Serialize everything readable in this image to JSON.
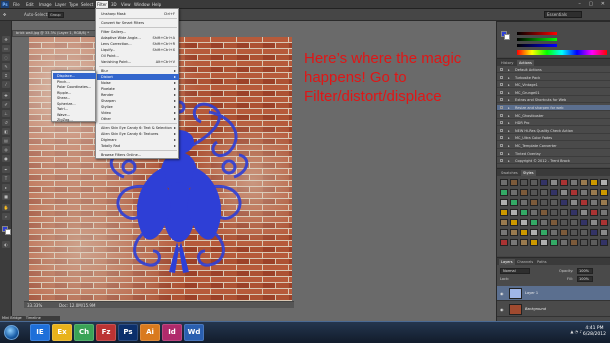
{
  "app": {
    "logo": "Ps"
  },
  "menubar": {
    "items": [
      "File",
      "Edit",
      "Image",
      "Layer",
      "Type",
      "Select",
      "Filter",
      "3D",
      "View",
      "Window",
      "Help"
    ]
  },
  "options_bar": {
    "auto_select_label": "Auto-Select:",
    "auto_select_value": "Group",
    "workspace": "Essentials"
  },
  "document": {
    "tab_title": "brick wall.jpg @ 33.3% (Layer 1, RGB/8) *",
    "zoom": "33.33%",
    "doc_size": "Doc: 12.0M/15.9M"
  },
  "filter_menu": {
    "items": [
      {
        "label": "Unsharp Mask",
        "shortcut": "Ctrl+F"
      },
      {
        "sep": true
      },
      {
        "label": "Convert for Smart Filters"
      },
      {
        "sep": true
      },
      {
        "label": "Filter Gallery..."
      },
      {
        "label": "Adaptive Wide Angle...",
        "shortcut": "Shift+Ctrl+A"
      },
      {
        "label": "Lens Correction...",
        "shortcut": "Shift+Ctrl+R"
      },
      {
        "label": "Liquify...",
        "shortcut": "Shift+Ctrl+X"
      },
      {
        "label": "Oil Paint..."
      },
      {
        "label": "Vanishing Point...",
        "shortcut": "Alt+Ctrl+V"
      },
      {
        "sep": true
      },
      {
        "label": "Blur",
        "submenu": true
      },
      {
        "label": "Distort",
        "submenu": true,
        "highlight": true
      },
      {
        "label": "Noise",
        "submenu": true
      },
      {
        "label": "Pixelate",
        "submenu": true
      },
      {
        "label": "Render",
        "submenu": true
      },
      {
        "label": "Sharpen",
        "submenu": true
      },
      {
        "label": "Stylize",
        "submenu": true
      },
      {
        "label": "Video",
        "submenu": true
      },
      {
        "label": "Other",
        "submenu": true
      },
      {
        "sep": true
      },
      {
        "label": "Alien Skin Eye Candy 6: Text & Selection",
        "submenu": true
      },
      {
        "label": "Alien Skin Eye Candy 6: Textures",
        "submenu": true
      },
      {
        "label": "Digimarc",
        "submenu": true
      },
      {
        "label": "Totally Rad",
        "submenu": true
      },
      {
        "sep": true
      },
      {
        "label": "Browse Filters Online..."
      }
    ]
  },
  "distort_menu": {
    "items": [
      "Displace...",
      "Pinch...",
      "Polar Coordinates...",
      "Ripple...",
      "Shear...",
      "Spherize...",
      "Twirl...",
      "Wave...",
      "ZigZag..."
    ],
    "highlighted": "Displace..."
  },
  "annotation": "Here’s where the magic happens! Go to Filter/distort/displace",
  "panels": {
    "history_tab": "History",
    "actions_tab": "Actions",
    "actions": [
      "Default Actions",
      "Turbosite Pack",
      "MC_Vintage1",
      "MC_Grunge01",
      "Extras and Shortcuts for Web",
      "Resize and sharpen for web",
      "MC_Ghostbuster",
      "HDR Pro",
      "NEW Hi-Res Quality Check Action",
      "MC_Ultra Color Fades",
      "MC_Template Converter",
      "Tinted Overlay",
      "Copyright © 2012 - Trent Brock"
    ],
    "selected_action_index": 5,
    "swatches_tab": "Swatches",
    "styles_tab": "Styles",
    "layers_tab": "Layers",
    "channels_tab": "Channels",
    "paths_tab": "Paths",
    "blend_mode": "Normal",
    "opacity_label": "Opacity:",
    "opacity": "100%",
    "lock_label": "Lock:",
    "fill_label": "Fill:",
    "fill": "100%",
    "layers": [
      {
        "name": "Layer 1",
        "selected": true
      },
      {
        "name": "Background",
        "selected": false
      }
    ]
  },
  "status": {
    "mini_bridge": "Mini Bridge",
    "timeline": "Timeline"
  },
  "taskbar": {
    "time": "4:41 PM",
    "date": "6/28/2012",
    "apps": [
      "IE",
      "Ex",
      "Ch",
      "Fz",
      "Ps",
      "Ai",
      "Id",
      "Wd"
    ]
  },
  "colors": {
    "brick": "#a04a2f",
    "graphic_blue": "#2e3fd6",
    "annotation_red": "#e01616",
    "menu_highlight": "#3366cc"
  }
}
